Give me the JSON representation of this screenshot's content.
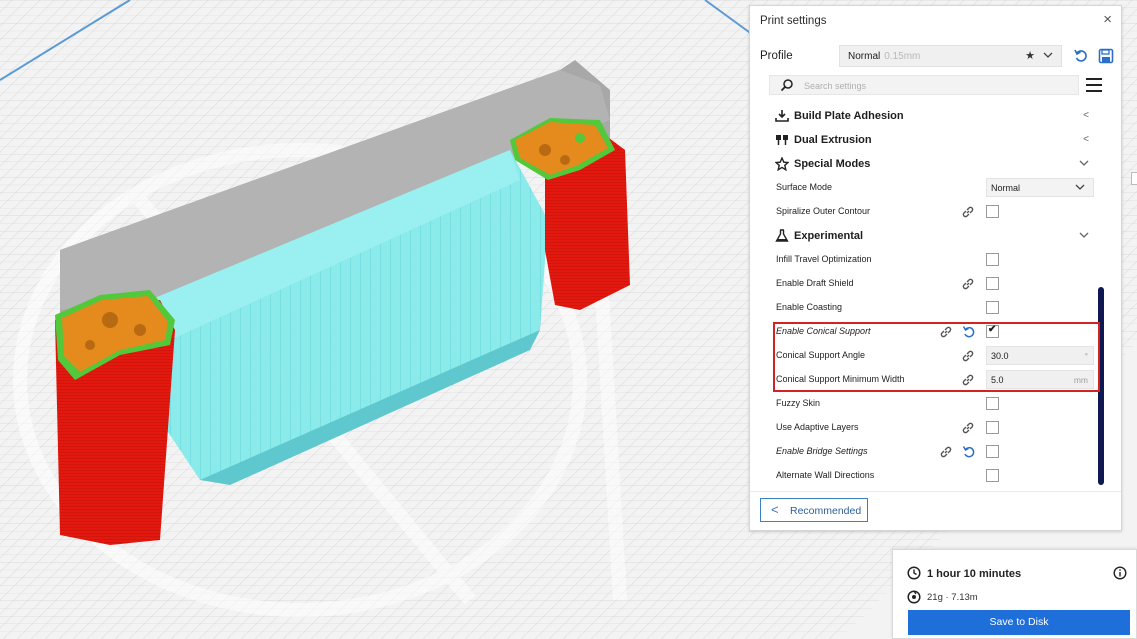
{
  "colors": {
    "accent": "#1e6fd9",
    "highlight_box": "#d32222",
    "support_red": "#e3180f",
    "infill_orange": "#e58a1c",
    "shell_green": "#52c83a",
    "support_cyan": "#7ae6e8",
    "model_gray": "#a9a9a9",
    "scrollbar": "#0f1850"
  },
  "print_settings": {
    "title": "Print settings",
    "close_icon": "close-icon",
    "profile": {
      "label": "Profile",
      "value": "Normal",
      "quality": "0.15mm"
    },
    "search": {
      "placeholder": "Search settings"
    },
    "categories": {
      "build_plate_adhesion": "Build Plate Adhesion",
      "dual_extrusion": "Dual Extrusion",
      "special_modes": "Special Modes",
      "experimental": "Experimental"
    },
    "settings": {
      "surface_mode": {
        "label": "Surface Mode",
        "value": "Normal"
      },
      "spiralize": {
        "label": "Spiralize Outer Contour",
        "checked": false
      },
      "infill_travel": {
        "label": "Infill Travel Optimization",
        "checked": false
      },
      "draft_shield": {
        "label": "Enable Draft Shield",
        "checked": false
      },
      "coasting": {
        "label": "Enable Coasting",
        "checked": false
      },
      "conical_support": {
        "label": "Enable Conical Support",
        "checked": true
      },
      "conical_angle": {
        "label": "Conical Support Angle",
        "value": "30.0",
        "unit": "°"
      },
      "conical_min_width": {
        "label": "Conical Support Minimum Width",
        "value": "5.0",
        "unit": "mm"
      },
      "fuzzy_skin": {
        "label": "Fuzzy Skin",
        "checked": false
      },
      "adaptive_layers": {
        "label": "Use Adaptive Layers",
        "checked": false
      },
      "bridge_settings": {
        "label": "Enable Bridge Settings",
        "checked": false
      },
      "alternate_walls": {
        "label": "Alternate Wall Directions",
        "checked": false
      }
    },
    "recommended_label": "Recommended"
  },
  "job": {
    "time": "1 hour 10 minutes",
    "material": "21g · 7.13m",
    "save_label": "Save to Disk"
  }
}
